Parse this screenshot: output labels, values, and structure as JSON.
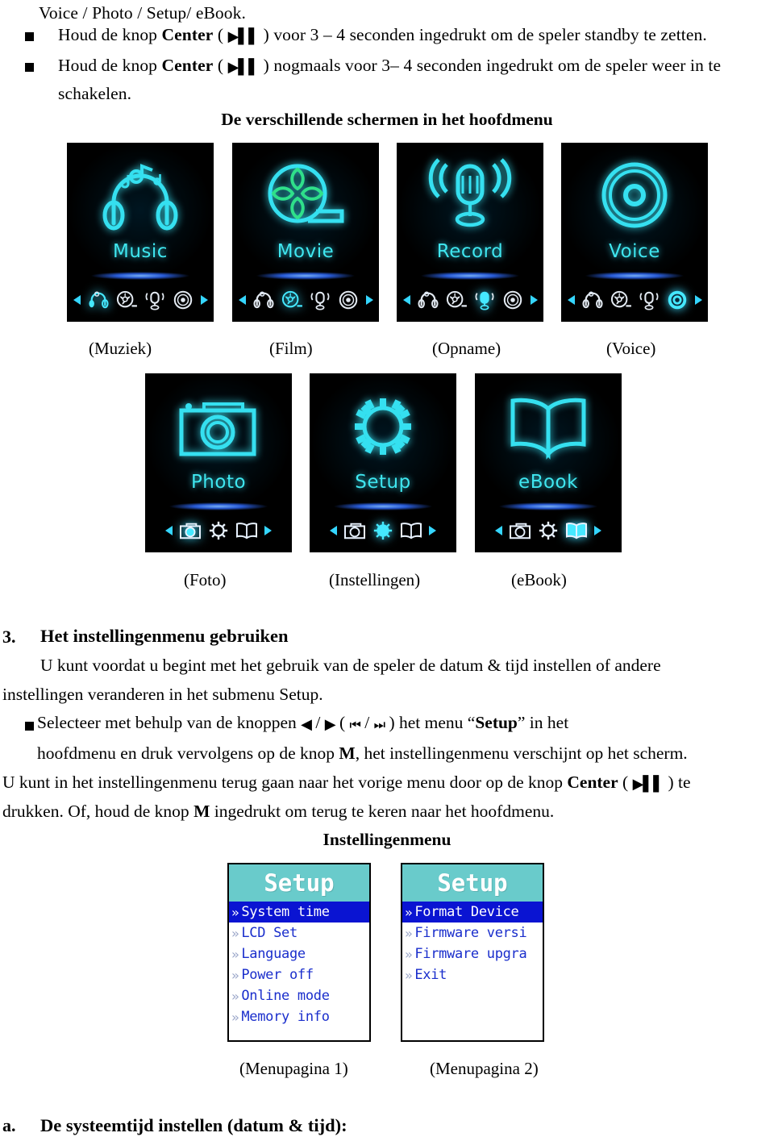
{
  "document": {
    "intro_line": "Voice / Photo / Setup/ eBook.",
    "bullets": [
      {
        "pre": "Houd de knop ",
        "bold": "Center",
        "mid": " ( ",
        "glyph": "play-pause",
        "post": " ) voor 3 – 4 seconden ingedrukt om de speler standby te zetten."
      },
      {
        "pre": "Houd de knop ",
        "bold": "Center",
        "mid": " ( ",
        "glyph": "play-pause",
        "post": " ) nogmaals voor 3– 4 seconden ingedrukt om de speler weer in te",
        "wrap": "schakelen."
      }
    ],
    "screens_heading": "De verschillende schermen in het hoofdmenu"
  },
  "main_menu_screens": {
    "row1": [
      {
        "label": "Music",
        "icon": "headphones-icon",
        "caption": "(Muziek)",
        "selected_index": 0
      },
      {
        "label": "Movie",
        "icon": "film-reel-icon",
        "caption": "(Film)",
        "selected_index": 1
      },
      {
        "label": "Record",
        "icon": "microphone-icon",
        "caption": "(Opname)",
        "selected_index": 2
      },
      {
        "label": "Voice",
        "icon": "disc-icon",
        "caption": "(Voice)",
        "selected_index": 3
      }
    ],
    "row2": [
      {
        "label": "Photo",
        "icon": "camera-icon",
        "caption": "(Foto)",
        "selected_index": 0
      },
      {
        "label": "Setup",
        "icon": "gear-icon",
        "caption": "(Instellingen)",
        "selected_index": 1
      },
      {
        "label": "eBook",
        "icon": "open-book-icon",
        "caption": "(eBook)",
        "selected_index": 2
      }
    ],
    "tray_row1": [
      "headphones-icon",
      "film-reel-icon",
      "microphone-icon",
      "disc-icon"
    ],
    "tray_row2": [
      "camera-icon",
      "gear-icon",
      "open-book-icon"
    ]
  },
  "section3": {
    "number": "3.",
    "title": "Het instellingenmenu gebruiken",
    "paragraph_lines": [
      "U kunt voordat u begint met het gebruik van de speler de datum & tijd instellen of andere",
      "instellingen veranderen in het submenu Setup."
    ],
    "bullet_line_pre": "Selecteer met behulp van de knoppen ",
    "bullet_glyph_prev": "◀",
    "bullet_slash1": " / ",
    "bullet_glyph_next": "▶",
    "bullet_mid": " ( ",
    "bullet_glyph_rew": "⏮",
    "bullet_slash2": " / ",
    "bullet_glyph_ff": "⏭",
    "bullet_post_a": " ) het menu “",
    "bullet_bold_setup": "Setup",
    "bullet_post_b": "” in het",
    "bullet_line2_a": "hoofdmenu en druk vervolgens op de knop ",
    "bullet_line2_bold": "M",
    "bullet_line2_b": ", het instellingenmenu verschijnt op het scherm.",
    "line3_a": "U kunt in het instellingenmenu terug gaan naar het vorige menu door op de knop ",
    "line3_bold": "Center",
    "line3_b": " ( ",
    "line3_glyph": "play-pause",
    "line3_c": " ) te",
    "line4_a": "drukken. Of, houd de knop ",
    "line4_bold": "M",
    "line4_b": " ingedrukt om terug te keren naar het hoofdmenu.",
    "menu_heading": "Instellingenmenu"
  },
  "setup_menu": {
    "page1": {
      "title": "Setup",
      "items": [
        {
          "label": "System time",
          "selected": true
        },
        {
          "label": "LCD Set",
          "selected": false
        },
        {
          "label": "Language",
          "selected": false
        },
        {
          "label": "Power off",
          "selected": false
        },
        {
          "label": "Online mode",
          "selected": false
        },
        {
          "label": "Memory info",
          "selected": false
        }
      ],
      "caption": "(Menupagina 1)"
    },
    "page2": {
      "title": "Setup",
      "items": [
        {
          "label": "Format Device",
          "selected": true
        },
        {
          "label": "Firmware versi",
          "selected": false
        },
        {
          "label": "Firmware upgra",
          "selected": false
        },
        {
          "label": "Exit",
          "selected": false
        }
      ],
      "caption": "(Menupagina 2)"
    },
    "chevron": "»"
  },
  "footer": {
    "letter": "a.",
    "title": "De systeemtijd instellen (datum & tijd):"
  },
  "colors": {
    "menu_header_teal": "#69cbcb",
    "menu_selected_blue": "#0a14d2",
    "menu_text_blue": "#1a2ecc",
    "screen_cyan": "#3fe6ef"
  }
}
